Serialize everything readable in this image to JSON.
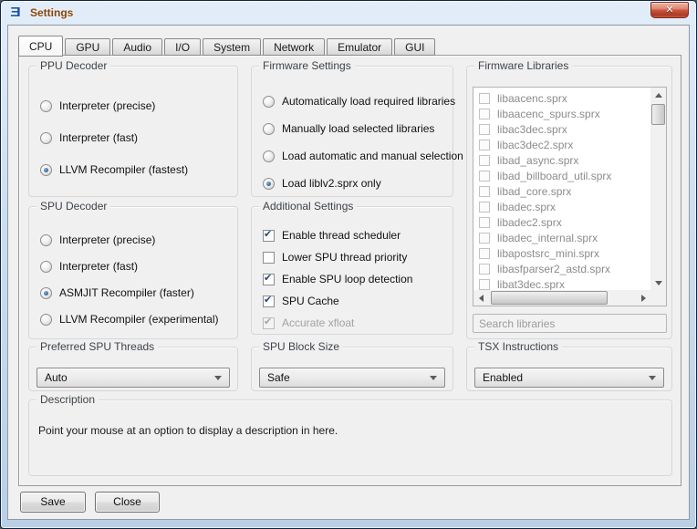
{
  "window": {
    "title": "Settings"
  },
  "icons": {
    "app_logo": "Ǝ",
    "close": "✕",
    "check": "✔"
  },
  "colors": {
    "titlebar_text": "#8a4507",
    "close_button_red": "#c14a33",
    "radio_selected_dot": "#2f5f94",
    "client_bg": "#f0f0f0",
    "disabled_text": "#a3a3a3"
  },
  "tabs": [
    {
      "label": "CPU",
      "active": true
    },
    {
      "label": "GPU",
      "active": false
    },
    {
      "label": "Audio",
      "active": false
    },
    {
      "label": "I/O",
      "active": false
    },
    {
      "label": "System",
      "active": false
    },
    {
      "label": "Network",
      "active": false
    },
    {
      "label": "Emulator",
      "active": false
    },
    {
      "label": "GUI",
      "active": false
    }
  ],
  "panels": {
    "ppu_decoder": {
      "title": "PPU Decoder",
      "options": [
        {
          "label": "Interpreter (precise)",
          "selected": false
        },
        {
          "label": "Interpreter (fast)",
          "selected": false
        },
        {
          "label": "LLVM Recompiler (fastest)",
          "selected": true
        }
      ]
    },
    "spu_decoder": {
      "title": "SPU Decoder",
      "options": [
        {
          "label": "Interpreter (precise)",
          "selected": false
        },
        {
          "label": "Interpreter (fast)",
          "selected": false
        },
        {
          "label": "ASMJIT Recompiler (faster)",
          "selected": true
        },
        {
          "label": "LLVM Recompiler (experimental)",
          "selected": false
        }
      ]
    },
    "firmware_settings": {
      "title": "Firmware Settings",
      "options": [
        {
          "label": "Automatically load required libraries",
          "selected": false
        },
        {
          "label": "Manually load selected libraries",
          "selected": false
        },
        {
          "label": "Load automatic and manual selection",
          "selected": false
        },
        {
          "label": "Load liblv2.sprx only",
          "selected": true
        }
      ]
    },
    "additional_settings": {
      "title": "Additional Settings",
      "options": [
        {
          "label": "Enable thread scheduler",
          "checked": true,
          "enabled": true
        },
        {
          "label": "Lower SPU thread priority",
          "checked": false,
          "enabled": true
        },
        {
          "label": "Enable SPU loop detection",
          "checked": true,
          "enabled": true
        },
        {
          "label": "SPU Cache",
          "checked": true,
          "enabled": true
        },
        {
          "label": "Accurate xfloat",
          "checked": true,
          "enabled": false
        }
      ]
    },
    "firmware_libraries": {
      "title": "Firmware Libraries",
      "items": [
        "libaacenc.sprx",
        "libaacenc_spurs.sprx",
        "libac3dec.sprx",
        "libac3dec2.sprx",
        "libad_async.sprx",
        "libad_billboard_util.sprx",
        "libad_core.sprx",
        "libadec.sprx",
        "libadec2.sprx",
        "libadec_internal.sprx",
        "libapostsrc_mini.sprx",
        "libasfparser2_astd.sprx",
        "libat3dec.sprx"
      ],
      "search_placeholder": "Search libraries"
    },
    "preferred_spu_threads": {
      "title": "Preferred SPU Threads",
      "value": "Auto"
    },
    "spu_block_size": {
      "title": "SPU Block Size",
      "value": "Safe"
    },
    "tsx_instructions": {
      "title": "TSX Instructions",
      "value": "Enabled"
    },
    "description": {
      "title": "Description",
      "text": "Point your mouse at an option to display a description in here."
    }
  },
  "buttons": {
    "save": "Save",
    "close": "Close"
  }
}
